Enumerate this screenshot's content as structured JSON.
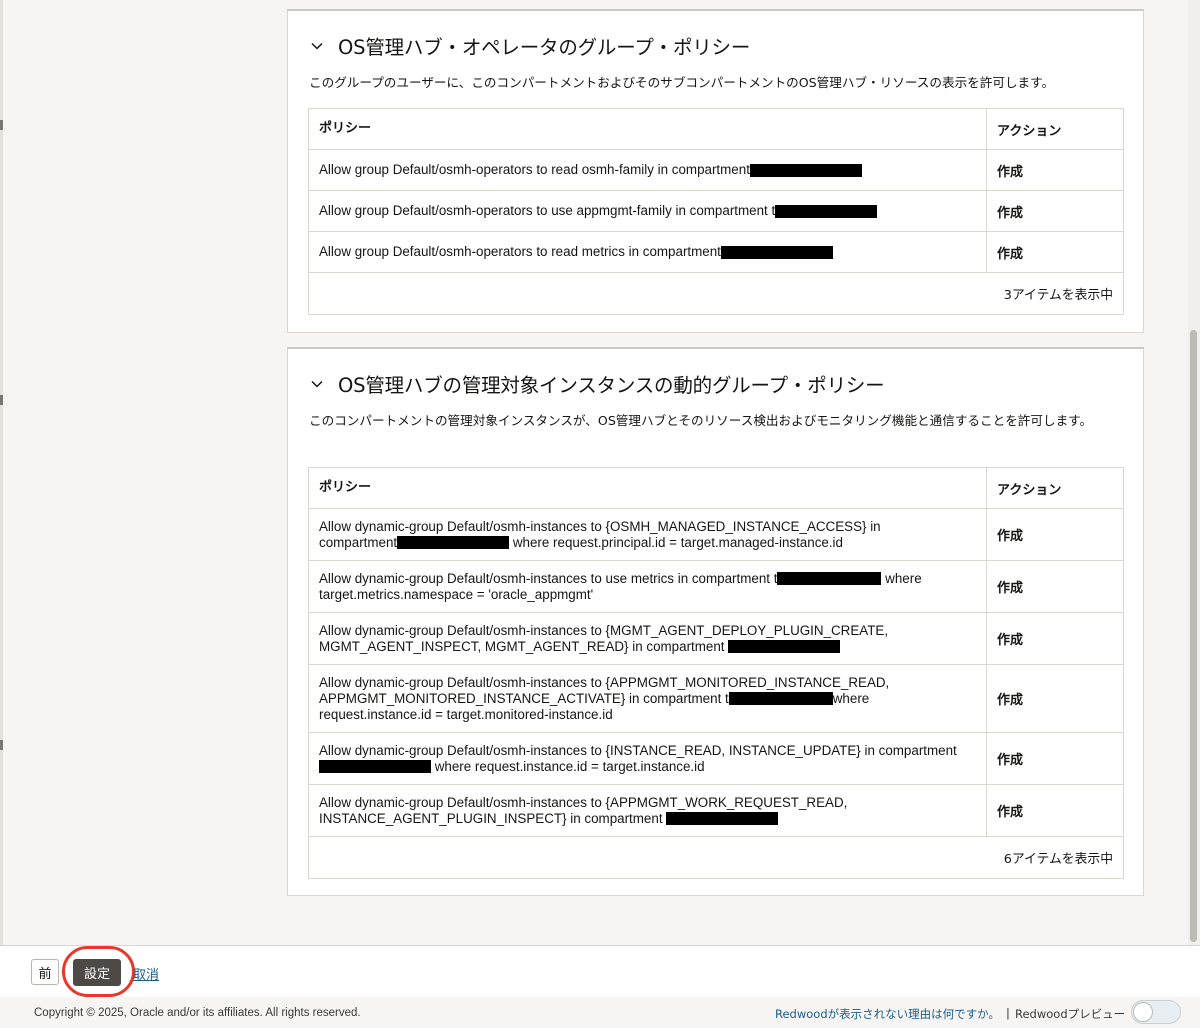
{
  "cards": [
    {
      "title": "OS管理ハブ・オペレータのグループ・ポリシー",
      "description": "このグループのユーザーに、このコンパートメントおよびそのサブコンパートメントのOS管理ハブ・リソースの表示を許可します。",
      "table": {
        "headers": {
          "policy": "ポリシー",
          "action": "アクション"
        },
        "rows": [
          {
            "policy": [
              "Allow group Default/osmh-operators to read osmh-family in compartment "
            ],
            "action": "作成"
          },
          {
            "policy": [
              "Allow group Default/osmh-operators to use appmgmt-family in compartment t"
            ],
            "action": "作成"
          },
          {
            "policy": [
              "Allow group Default/osmh-operators to read metrics in compartment "
            ],
            "action": "作成"
          }
        ],
        "footer": "3アイテムを表示中"
      }
    },
    {
      "title": "OS管理ハブの管理対象インスタンスの動的グループ・ポリシー",
      "description": "このコンパートメントの管理対象インスタンスが、OS管理ハブとそのリソース検出およびモニタリング機能と通信することを許可します。",
      "table": {
        "headers": {
          "policy": "ポリシー",
          "action": "アクション"
        },
        "rows": [
          {
            "policy": [
              "Allow dynamic-group Default/osmh-instances to {OSMH_MANAGED_INSTANCE_ACCESS} in",
              "compartment",
              " where request.principal.id = target.managed-instance.id"
            ],
            "action": "作成"
          },
          {
            "policy": [
              "Allow dynamic-group Default/osmh-instances to use metrics in compartment t",
              " where",
              "target.metrics.namespace = 'oracle_appmgmt'"
            ],
            "action": "作成"
          },
          {
            "policy": [
              "Allow dynamic-group Default/osmh-instances to {MGMT_AGENT_DEPLOY_PLUGIN_CREATE,",
              "MGMT_AGENT_INSPECT, MGMT_AGENT_READ} in compartment "
            ],
            "action": "作成"
          },
          {
            "policy": [
              "Allow dynamic-group Default/osmh-instances to {APPMGMT_MONITORED_INSTANCE_READ,",
              "APPMGMT_MONITORED_INSTANCE_ACTIVATE} in compartment t",
              "where",
              "request.instance.id = target.monitored-instance.id"
            ],
            "action": "作成"
          },
          {
            "policy": [
              "Allow dynamic-group Default/osmh-instances to {INSTANCE_READ, INSTANCE_UPDATE} in compartment",
              " where request.instance.id = target.instance.id"
            ],
            "action": "作成"
          },
          {
            "policy": [
              "Allow dynamic-group Default/osmh-instances to {APPMGMT_WORK_REQUEST_READ,",
              "INSTANCE_AGENT_PLUGIN_INSPECT} in compartment "
            ],
            "action": "作成"
          }
        ],
        "footer": "6アイテムを表示中"
      }
    }
  ],
  "bottom_bar": {
    "prev_label": "前",
    "setup_label": "設定",
    "cancel_label": "取消"
  },
  "footer": {
    "copyright": "Copyright © 2025, Oracle and/or its affiliates. All rights reserved.",
    "redwood_link": "Redwoodが表示されない理由は何ですか。",
    "separator": "|",
    "preview_label": "Redwoodプレビュー"
  },
  "colors": {
    "primary_button": "#4d4a46",
    "highlight": "#e8372b",
    "link": "#1b5d8f",
    "redaction": "#000000"
  }
}
